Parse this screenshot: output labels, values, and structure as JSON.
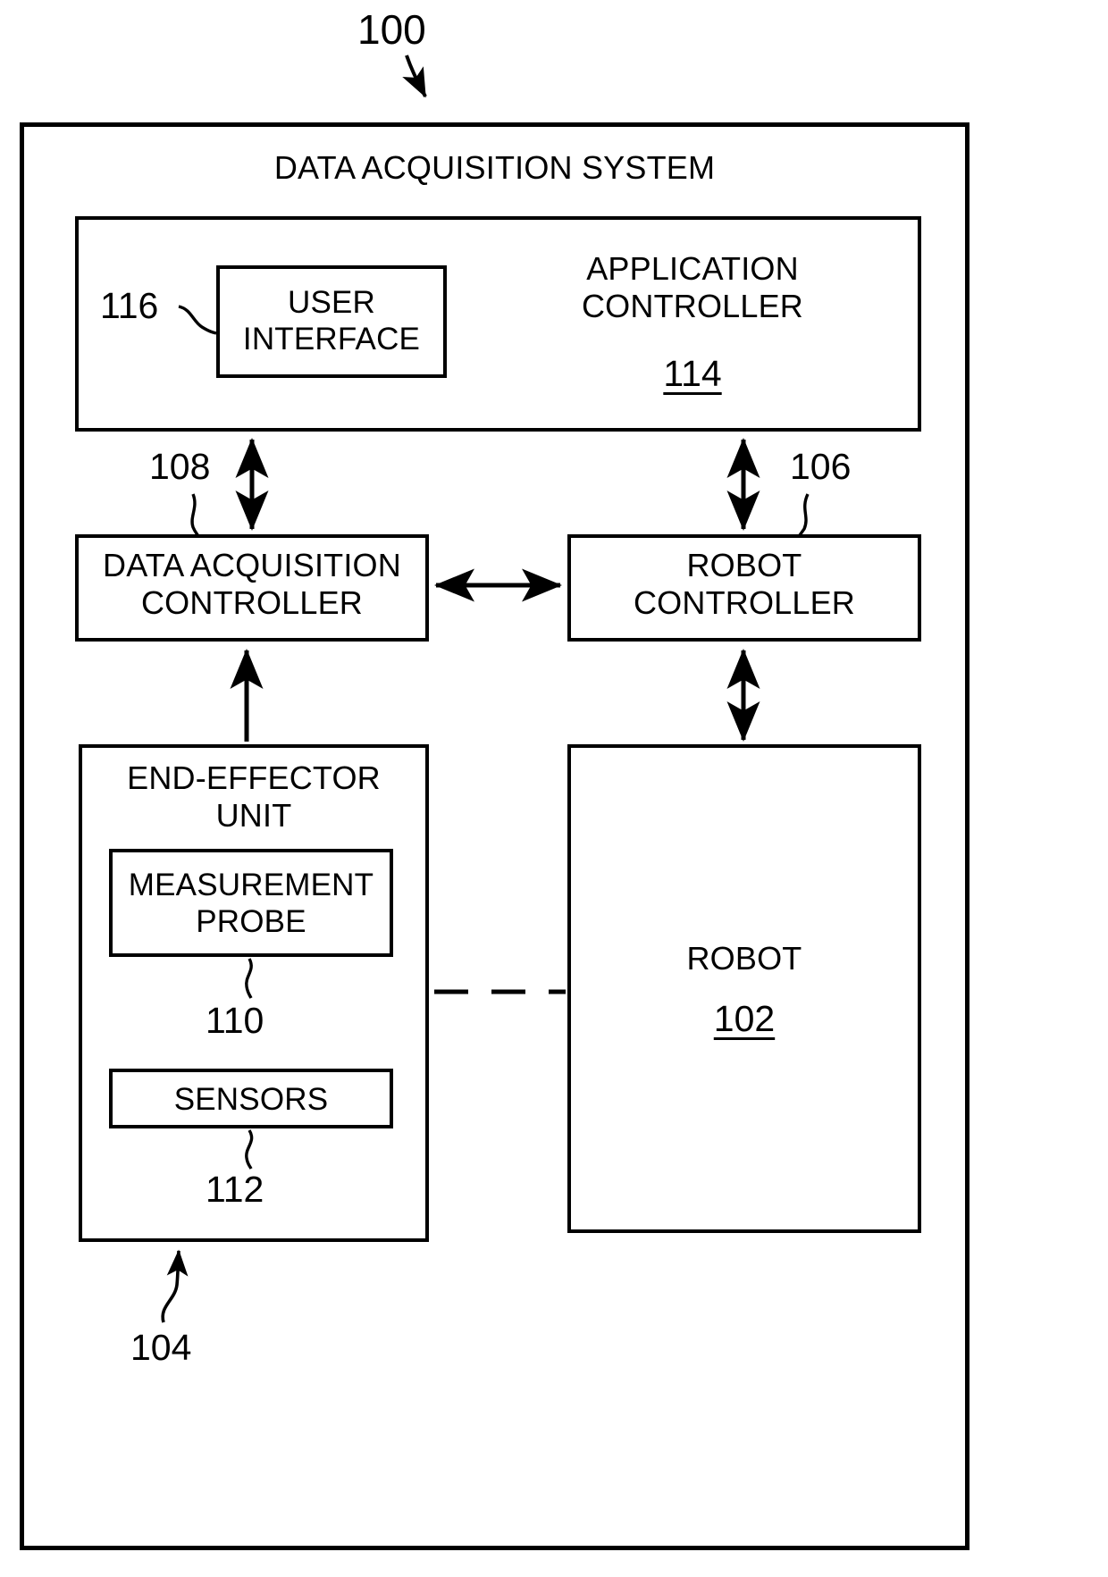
{
  "figure": {
    "number": "100",
    "system_title": "DATA ACQUISITION SYSTEM"
  },
  "blocks": {
    "application_controller": {
      "title": "APPLICATION\nCONTROLLER",
      "ref": "114"
    },
    "user_interface": {
      "title": "USER\nINTERFACE",
      "ref": "116"
    },
    "data_acquisition_controller": {
      "title": "DATA ACQUISITION\nCONTROLLER",
      "ref": "108"
    },
    "robot_controller": {
      "title": "ROBOT\nCONTROLLER",
      "ref": "106"
    },
    "end_effector_unit": {
      "title": "END-EFFECTOR\nUNIT",
      "ref": "104"
    },
    "measurement_probe": {
      "title": "MEASUREMENT\nPROBE",
      "ref": "110"
    },
    "sensors": {
      "title": "SENSORS",
      "ref": "112"
    },
    "robot": {
      "title": "ROBOT",
      "ref": "102"
    }
  },
  "connectors": [
    {
      "name": "app-controller-to-daq-controller",
      "style": "double-arrow-vertical"
    },
    {
      "name": "app-controller-to-robot-controller",
      "style": "double-arrow-vertical"
    },
    {
      "name": "daq-controller-to-robot-controller",
      "style": "double-arrow-horizontal"
    },
    {
      "name": "end-effector-to-daq-controller",
      "style": "single-arrow-up"
    },
    {
      "name": "robot-to-robot-controller",
      "style": "double-arrow-vertical"
    },
    {
      "name": "end-effector-to-robot",
      "style": "dashed-line"
    }
  ],
  "colors": {
    "stroke": "#000000",
    "background": "#ffffff"
  }
}
